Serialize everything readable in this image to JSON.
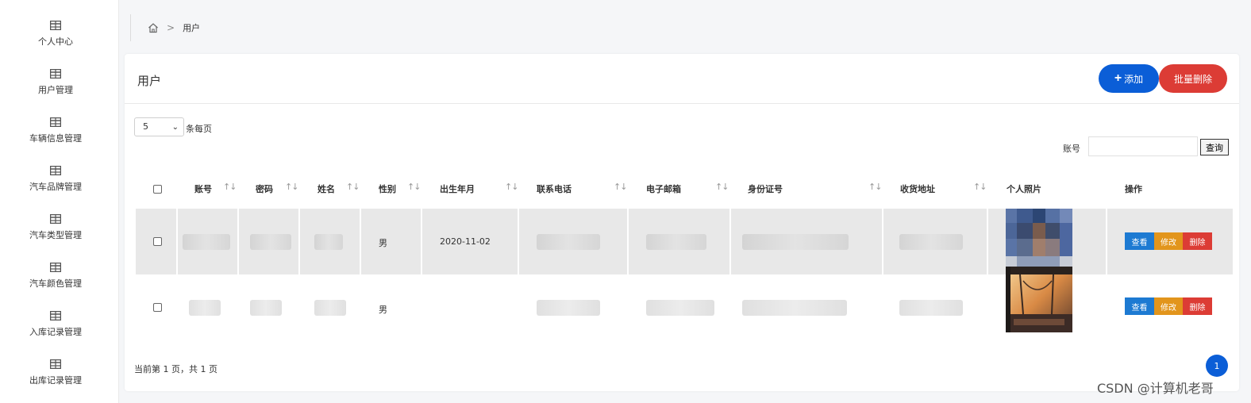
{
  "sidebar": {
    "items": [
      {
        "label": "个人中心",
        "icon": "table-icon"
      },
      {
        "label": "用户管理",
        "icon": "table-icon"
      },
      {
        "label": "车辆信息管理",
        "icon": "table-icon"
      },
      {
        "label": "汽车品牌管理",
        "icon": "table-icon"
      },
      {
        "label": "汽车类型管理",
        "icon": "table-icon"
      },
      {
        "label": "汽车颜色管理",
        "icon": "table-icon"
      },
      {
        "label": "入库记录管理",
        "icon": "table-icon"
      },
      {
        "label": "出库记录管理",
        "icon": "table-icon"
      }
    ]
  },
  "breadcrumb": {
    "home_icon": "home-icon",
    "separator": ">",
    "current": "用户"
  },
  "card": {
    "title": "用户",
    "add_label": "添加",
    "batch_delete_label": "批量删除"
  },
  "pager": {
    "page_size": "5",
    "page_size_label": "条每页",
    "info": "当前第 1 页，共 1 页",
    "current_page": "1"
  },
  "search": {
    "label": "账号",
    "value": "",
    "button": "查询"
  },
  "table": {
    "headers": [
      "账号",
      "密码",
      "姓名",
      "性别",
      "出生年月",
      "联系电话",
      "电子邮箱",
      "身份证号",
      "收货地址",
      "个人照片",
      "操作"
    ],
    "rows": [
      {
        "gender": "男",
        "birth": "2020-11-02"
      },
      {
        "gender": "男",
        "birth": ""
      }
    ],
    "actions": {
      "view": "查看",
      "edit": "修改",
      "delete": "删除"
    }
  },
  "colors": {
    "primary": "#0b5ed7",
    "danger": "#dc3c35",
    "warning": "#e2951c",
    "info": "#1d7ad2"
  },
  "watermark": "CSDN @计算机老哥"
}
